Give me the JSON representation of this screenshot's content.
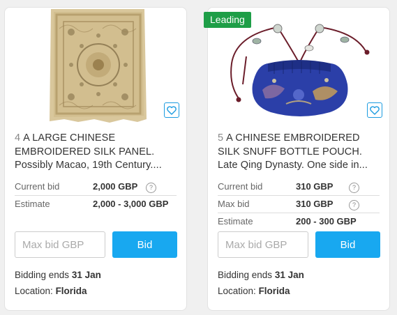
{
  "lots": [
    {
      "badge": "",
      "number": "4",
      "title": "A LARGE CHINESE EMBROIDERED SILK PANEL. Possibly Macao, 19th Century....",
      "rows": [
        {
          "label": "Current bid",
          "value": "2,000 GBP",
          "help": true
        },
        {
          "label": "Estimate",
          "value": "2,000 - 3,000 GBP",
          "help": false
        }
      ],
      "max_bid_placeholder": "Max bid GBP",
      "bid_label": "Bid",
      "bidding_ends_label": "Bidding ends",
      "bidding_ends_value": "31 Jan",
      "location_label": "Location:",
      "location_value": "Florida",
      "image_icon": "embroidered-silk-panel-image"
    },
    {
      "badge": "Leading",
      "number": "5",
      "title": "A CHINESE EMBROIDERED SILK SNUFF BOTTLE POUCH. Late Qing Dynasty. One side in...",
      "rows": [
        {
          "label": "Current bid",
          "value": "310 GBP",
          "help": true
        },
        {
          "label": "Max bid",
          "value": "310 GBP",
          "help": true
        },
        {
          "label": "Estimate",
          "value": "200 - 300 GBP",
          "help": false
        }
      ],
      "max_bid_placeholder": "Max bid GBP",
      "bid_label": "Bid",
      "bidding_ends_label": "Bidding ends",
      "bidding_ends_value": "31 Jan",
      "location_label": "Location:",
      "location_value": "Florida",
      "image_icon": "silk-pouch-image"
    }
  ],
  "colors": {
    "accent": "#18a8f0",
    "heart_border": "#1a9be0",
    "badge_bg": "#1e9e47"
  }
}
